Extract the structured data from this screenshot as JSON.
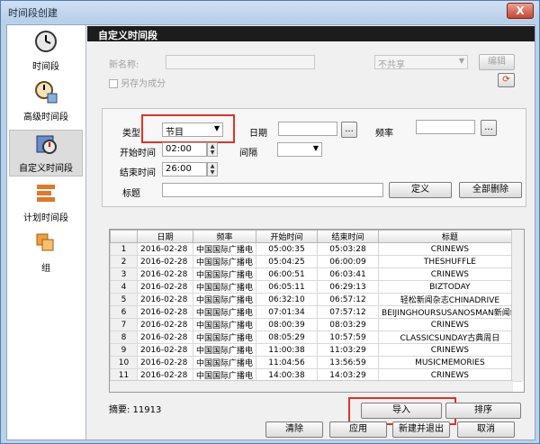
{
  "window": {
    "title": "时间段创建",
    "close": "X"
  },
  "sidebar": {
    "items": [
      {
        "label": "时间段"
      },
      {
        "label": "高级时间段"
      },
      {
        "label": "自定义时间段"
      },
      {
        "label": "计划时间段"
      },
      {
        "label": "组"
      }
    ]
  },
  "header": {
    "title": "自定义时间段"
  },
  "top_form": {
    "name_label": "新名称:",
    "name_value": "",
    "share_select": "不共享",
    "edit_button": "编辑",
    "save_as_component": "另存为成分"
  },
  "filter": {
    "type_label": "类型",
    "type_value": "节目",
    "date_label": "日期",
    "date_value": "",
    "freq_label": "频率",
    "freq_value": "",
    "browse": "...",
    "start_label": "开始时间",
    "start_value": "02:00",
    "interval_label": "间隔",
    "interval_value": "",
    "end_label": "结束时间",
    "end_value": "26:00",
    "title_label": "标题",
    "title_value": "",
    "define_button": "定义",
    "delete_all_button": "全部删除"
  },
  "table": {
    "columns": [
      "",
      "日期",
      "频率",
      "开始时间",
      "结束时间",
      "标题"
    ],
    "rows": [
      [
        "1",
        "2016-02-28",
        "中国国际广播电",
        "05:00:35",
        "05:03:28",
        "CRINEWS"
      ],
      [
        "2",
        "2016-02-28",
        "中国国际广播电",
        "05:04:25",
        "06:00:09",
        "THESHUFFLE"
      ],
      [
        "3",
        "2016-02-28",
        "中国国际广播电",
        "06:00:51",
        "06:03:41",
        "CRINEWS"
      ],
      [
        "4",
        "2016-02-28",
        "中国国际广播电",
        "06:05:11",
        "06:29:13",
        "BIZTODAY"
      ],
      [
        "5",
        "2016-02-28",
        "中国国际广播电",
        "06:32:10",
        "06:57:12",
        "轻松新闻杂志CHINADRIVE"
      ],
      [
        "6",
        "2016-02-28",
        "中国国际广播电",
        "07:01:34",
        "07:57:12",
        "BEIJINGHOURSUSANOSMAN新闻纵"
      ],
      [
        "7",
        "2016-02-28",
        "中国国际广播电",
        "08:00:39",
        "08:03:29",
        "CRINEWS"
      ],
      [
        "8",
        "2016-02-28",
        "中国国际广播电",
        "08:05:29",
        "10:57:59",
        "CLASSICSUNDAY古典周日"
      ],
      [
        "9",
        "2016-02-28",
        "中国国际广播电",
        "11:00:38",
        "11:03:29",
        "CRINEWS"
      ],
      [
        "10",
        "2016-02-28",
        "中国国际广播电",
        "11:04:56",
        "13:56:59",
        "MUSICMEMORIES"
      ],
      [
        "11",
        "2016-02-28",
        "中国国际广播电",
        "14:00:38",
        "14:03:29",
        "CRINEWS"
      ]
    ]
  },
  "summary": {
    "text": "摘要: 11913"
  },
  "actions": {
    "import_button": "导入",
    "sort_button": "排序"
  },
  "footer": {
    "clear": "清除",
    "apply": "应用",
    "create_exit": "新建并退出",
    "cancel": "取消"
  },
  "colors": {
    "highlight": "#e0312a",
    "header": "#1c1c1c"
  }
}
